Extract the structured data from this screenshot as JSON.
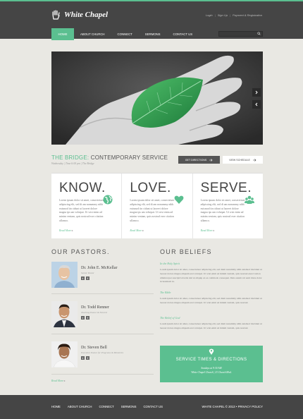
{
  "brand": {
    "name": "White Chapel"
  },
  "top_links": [
    "Login",
    "Sign Up",
    "Payment & Registration"
  ],
  "nav": {
    "items": [
      "Home",
      "About Church",
      "Connect",
      "Sermons",
      "Contact Us"
    ],
    "active": "Home"
  },
  "search": {
    "placeholder": ""
  },
  "event": {
    "title_accent": "The Bridge:",
    "title_rest": "Contemporary Service",
    "meta": "Wednesday  |  Time 6:00 pm  |  The Bridge",
    "get_directions": "Get Directions",
    "view_schedule": "View Schedule"
  },
  "features": [
    {
      "heading": "KNOW.",
      "icon": "globe-icon",
      "text": "Lorem ipsum dolor sit amet, consectetuer adipiscing elit, sed di am nonummy nibh euismod tin cidunt ut laoreet dolore magna ips um volutpat. Ut wisi enim ad minim veniam, quis nostrud exer citation ullamco.",
      "more": "Read More"
    },
    {
      "heading": "LOVE.",
      "icon": "heart-icon",
      "text": "Lorem ipsum dolor sit amet, consectetuer adipiscing elit, sed di am nonummy nibh euismod tin cidunt ut laoreet dolore magna ips um volutpat. Ut wisi enim ad minim veniam, quis nostrud exer citation ullamco.",
      "more": "Read More"
    },
    {
      "heading": "SERVE.",
      "icon": "people-icon",
      "text": "Lorem ipsum dolor sit amet, consectetuer adipiscing elit, sed di am nonummy nibh euismod tin cidunt ut laoreet dolore magna ips um volutpat. Ut wisi enim ad minim veniam, quis nostrud exer citation ullamco.",
      "more": "Read More"
    }
  ],
  "pastors_title": "Our Pastors.",
  "pastors": [
    {
      "name": "Dr. John E. McKellar",
      "role": "Senior Pastor"
    },
    {
      "name": "Dr. Todd Renner",
      "role": "Teaching Pastor & Elected"
    },
    {
      "name": "Dr. Steven Bell",
      "role": "Executive Pastor for Programs & Ministries"
    }
  ],
  "pastors_more": "Read More",
  "beliefs_title": "Our Beliefs",
  "beliefs": [
    {
      "title": "In the Holy Spirit",
      "text": "Lorem ipsum dolor sit amet, consectetuer adipiscing elit, sed diam nonummy nibh euismod tincidunt ut laoreet dolore magna aliquam erat volutpat. Ut wisi enim ad minim veniam, quis nostrud exerci tation ullamcorper suscipit lobortis nisl ut aliquip ex ea commodo consequat. Duis autem vel eum iriure dolor in hendrerit in."
    },
    {
      "title": "The Bible",
      "text": "Lorem ipsum dolor sit amet, consectetuer adipiscing elit, sed diam nonummy nibh euismod tincidunt ut laoreet dolore magna aliquam erat volutpat. Ut wisi enim ad minim veniam, quis nostrud."
    },
    {
      "title": "The Belief of God",
      "text": "Lorem ipsum dolor sit amet, consectetuer adipiscing elit, sed diam nonummy nibh euismod tincidunt ut laoreet dolore magna aliquam erat volutpat. Ut wisi enim ad minim veniam, quis nostrud."
    }
  ],
  "service": {
    "title": "Service Times & Directions",
    "line1": "Sundays at 9:30 AM",
    "line2": "White Chapel Church  |  23 Church Blvd."
  },
  "footer": {
    "nav": [
      "Home",
      "About Church",
      "Connect",
      "Sermons",
      "Contact Us"
    ],
    "copyright": "White Chapel © 2013 • Privacy Policy"
  },
  "colors": {
    "accent": "#5bbf90",
    "bar": "#454545",
    "page": "#e9e8e3"
  }
}
